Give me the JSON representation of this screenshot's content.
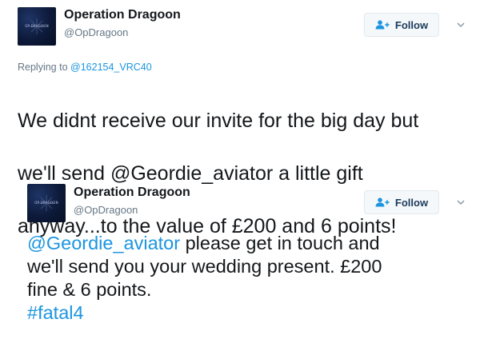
{
  "tweets": [
    {
      "author": {
        "display_name": "Operation Dragoon",
        "handle": "@OpDragoon",
        "avatar_text": "OP DRAGOON"
      },
      "follow_label": "Follow",
      "reply_prefix": "Replying to",
      "reply_to": "@162154_VRC40",
      "text_lines": [
        "We didnt receive our invite for the big day but",
        "we'll send @Geordie_aviator a little gift",
        "anyway...to the value of £200 and 6 points!"
      ]
    },
    {
      "author": {
        "display_name": "Operation Dragoon",
        "handle": "@OpDragoon",
        "avatar_text": "OP DRAGOON"
      },
      "follow_label": "Follow",
      "text": {
        "mention": "@Geordie_aviator",
        "line1_rest": " please get in touch and",
        "line2": "we'll send you your wedding present. £200",
        "line3": "fine & 6 points.",
        "hashtag": "#fatal4"
      }
    }
  ],
  "colors": {
    "link": "#1b95e0",
    "text": "#14171a",
    "secondary": "#657786",
    "avatar_bg": "#0d1a3a"
  },
  "icons": {
    "follow": "add-user-icon",
    "more": "chevron-down-icon"
  }
}
